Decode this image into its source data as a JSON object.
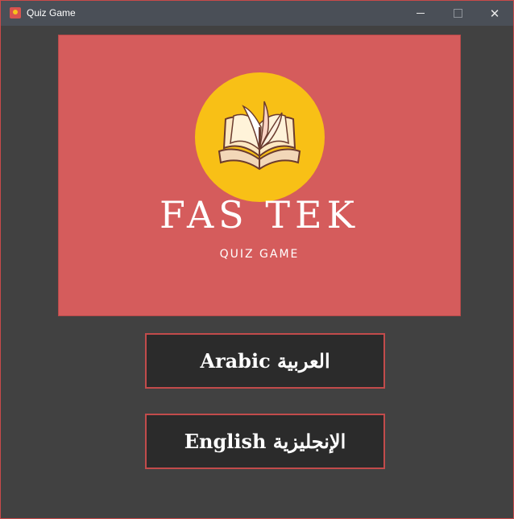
{
  "window": {
    "title": "Quiz Game",
    "icons": {
      "app": "quiz-app-icon",
      "minimize": "minimize-icon",
      "maximize": "maximize-icon",
      "close": "close-icon"
    },
    "close_glyph": "✕"
  },
  "banner": {
    "logo_icon": "open-book-icon",
    "brand": "FAS TEK",
    "subtitle": "QUIZ GAME",
    "colors": {
      "background": "#d55c5c",
      "circle": "#f8c016"
    }
  },
  "buttons": {
    "arabic_label": "Arabic العربية",
    "english_label": "English الإنجليزية",
    "border_color": "#c24b4b"
  }
}
